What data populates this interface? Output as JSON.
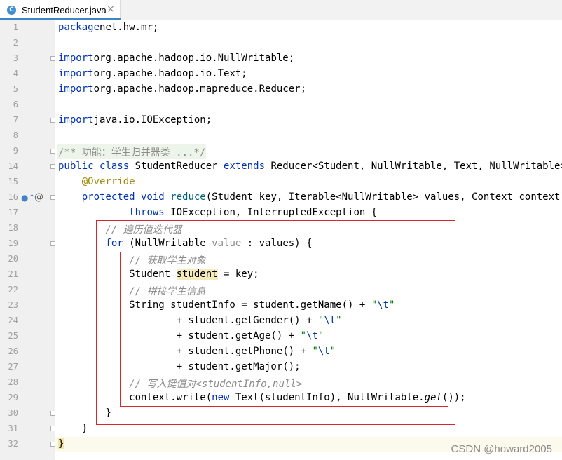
{
  "tab": {
    "icon": "C",
    "label": "StudentReducer.java",
    "close": "×"
  },
  "gutter_icons": {
    "implements_icon": "●↑",
    "override_icon": "@"
  },
  "lines": [
    {
      "n": "1",
      "tokens": [
        [
          "kw",
          "package"
        ],
        [
          "",
          "net.hw.mr;"
        ]
      ]
    },
    {
      "n": "2",
      "tokens": []
    },
    {
      "n": "3",
      "tokens": [
        [
          "kw",
          "import"
        ],
        [
          "",
          "org.apache.hadoop.io.NullWritable;"
        ]
      ]
    },
    {
      "n": "4",
      "tokens": [
        [
          "kw",
          "import"
        ],
        [
          "",
          "org.apache.hadoop.io.Text;"
        ]
      ]
    },
    {
      "n": "5",
      "tokens": [
        [
          "kw",
          "import"
        ],
        [
          "",
          "org.apache.hadoop.mapreduce.Reducer;"
        ]
      ]
    },
    {
      "n": "6",
      "tokens": []
    },
    {
      "n": "7",
      "tokens": [
        [
          "kw",
          "import"
        ],
        [
          "",
          "java.io.IOException;"
        ]
      ]
    },
    {
      "n": "8",
      "tokens": []
    },
    {
      "n": "9",
      "tokens": [
        [
          "",
          "/** 功能：学生归并器类 ...*/"
        ]
      ]
    },
    {
      "n": "14",
      "tokens": [
        [
          "kw",
          "public class "
        ],
        [
          "",
          "StudentReducer "
        ],
        [
          "kw",
          "extends "
        ],
        [
          "",
          "Reducer<Student, NullWritable, Text, NullWritable> "
        ],
        [
          "brace",
          "{"
        ]
      ]
    },
    {
      "n": "15",
      "tokens": [
        [
          "",
          "    "
        ],
        [
          "ann",
          "@Override"
        ]
      ]
    },
    {
      "n": "16",
      "tokens": [
        [
          "",
          "    "
        ],
        [
          "kw",
          "protected void "
        ],
        [
          "method",
          "reduce"
        ],
        [
          "",
          "(Student key, Iterable<NullWritable> values, Context context)"
        ]
      ]
    },
    {
      "n": "17",
      "tokens": [
        [
          "",
          "            "
        ],
        [
          "kw",
          "throws "
        ],
        [
          "",
          "IOException, InterruptedException {"
        ]
      ]
    },
    {
      "n": "18",
      "tokens": [
        [
          "",
          "        "
        ],
        [
          "cm",
          "// 遍历值迭代器"
        ]
      ]
    },
    {
      "n": "19",
      "tokens": [
        [
          "",
          "        "
        ],
        [
          "kw",
          "for "
        ],
        [
          "",
          "(NullWritable "
        ],
        [
          "unused",
          "value"
        ],
        [
          "",
          " : values) {"
        ]
      ]
    },
    {
      "n": "20",
      "tokens": [
        [
          "",
          "            "
        ],
        [
          "cm",
          "// 获取学生对象"
        ]
      ]
    },
    {
      "n": "21",
      "tokens": [
        [
          "",
          "            Student "
        ],
        [
          "hlvar",
          "student"
        ],
        [
          "",
          " = key;"
        ]
      ]
    },
    {
      "n": "22",
      "tokens": [
        [
          "",
          "            "
        ],
        [
          "cm",
          "// 拼接学生信息"
        ]
      ]
    },
    {
      "n": "23",
      "tokens": [
        [
          "",
          "            String studentInfo = student.getName() + "
        ],
        [
          "str",
          "\""
        ],
        [
          "esc",
          "\\t"
        ],
        [
          "str",
          "\""
        ]
      ]
    },
    {
      "n": "24",
      "tokens": [
        [
          "",
          "                    + student.getGender() + "
        ],
        [
          "str",
          "\""
        ],
        [
          "esc",
          "\\t"
        ],
        [
          "str",
          "\""
        ]
      ]
    },
    {
      "n": "25",
      "tokens": [
        [
          "",
          "                    + student.getAge() + "
        ],
        [
          "str",
          "\""
        ],
        [
          "esc",
          "\\t"
        ],
        [
          "str",
          "\""
        ]
      ]
    },
    {
      "n": "26",
      "tokens": [
        [
          "",
          "                    + student.getPhone() + "
        ],
        [
          "str",
          "\""
        ],
        [
          "esc",
          "\\t"
        ],
        [
          "str",
          "\""
        ]
      ]
    },
    {
      "n": "27",
      "tokens": [
        [
          "",
          "                    + student.getMajor();"
        ]
      ]
    },
    {
      "n": "28",
      "tokens": [
        [
          "",
          "            "
        ],
        [
          "cm",
          "// 写入键值对<studentInfo,null>"
        ]
      ]
    },
    {
      "n": "29",
      "tokens": [
        [
          "",
          "            context.write("
        ],
        [
          "kw",
          "new "
        ],
        [
          "",
          "Text(studentInfo), NullWritable."
        ],
        [
          "italic",
          "get"
        ],
        [
          "",
          "());"
        ]
      ]
    },
    {
      "n": "30",
      "tokens": [
        [
          "",
          "        }"
        ]
      ]
    },
    {
      "n": "31",
      "tokens": [
        [
          "",
          "    }"
        ]
      ]
    },
    {
      "n": "32",
      "tokens": [
        [
          "brace",
          "}"
        ]
      ]
    }
  ],
  "watermark": "CSDN @howard2005"
}
